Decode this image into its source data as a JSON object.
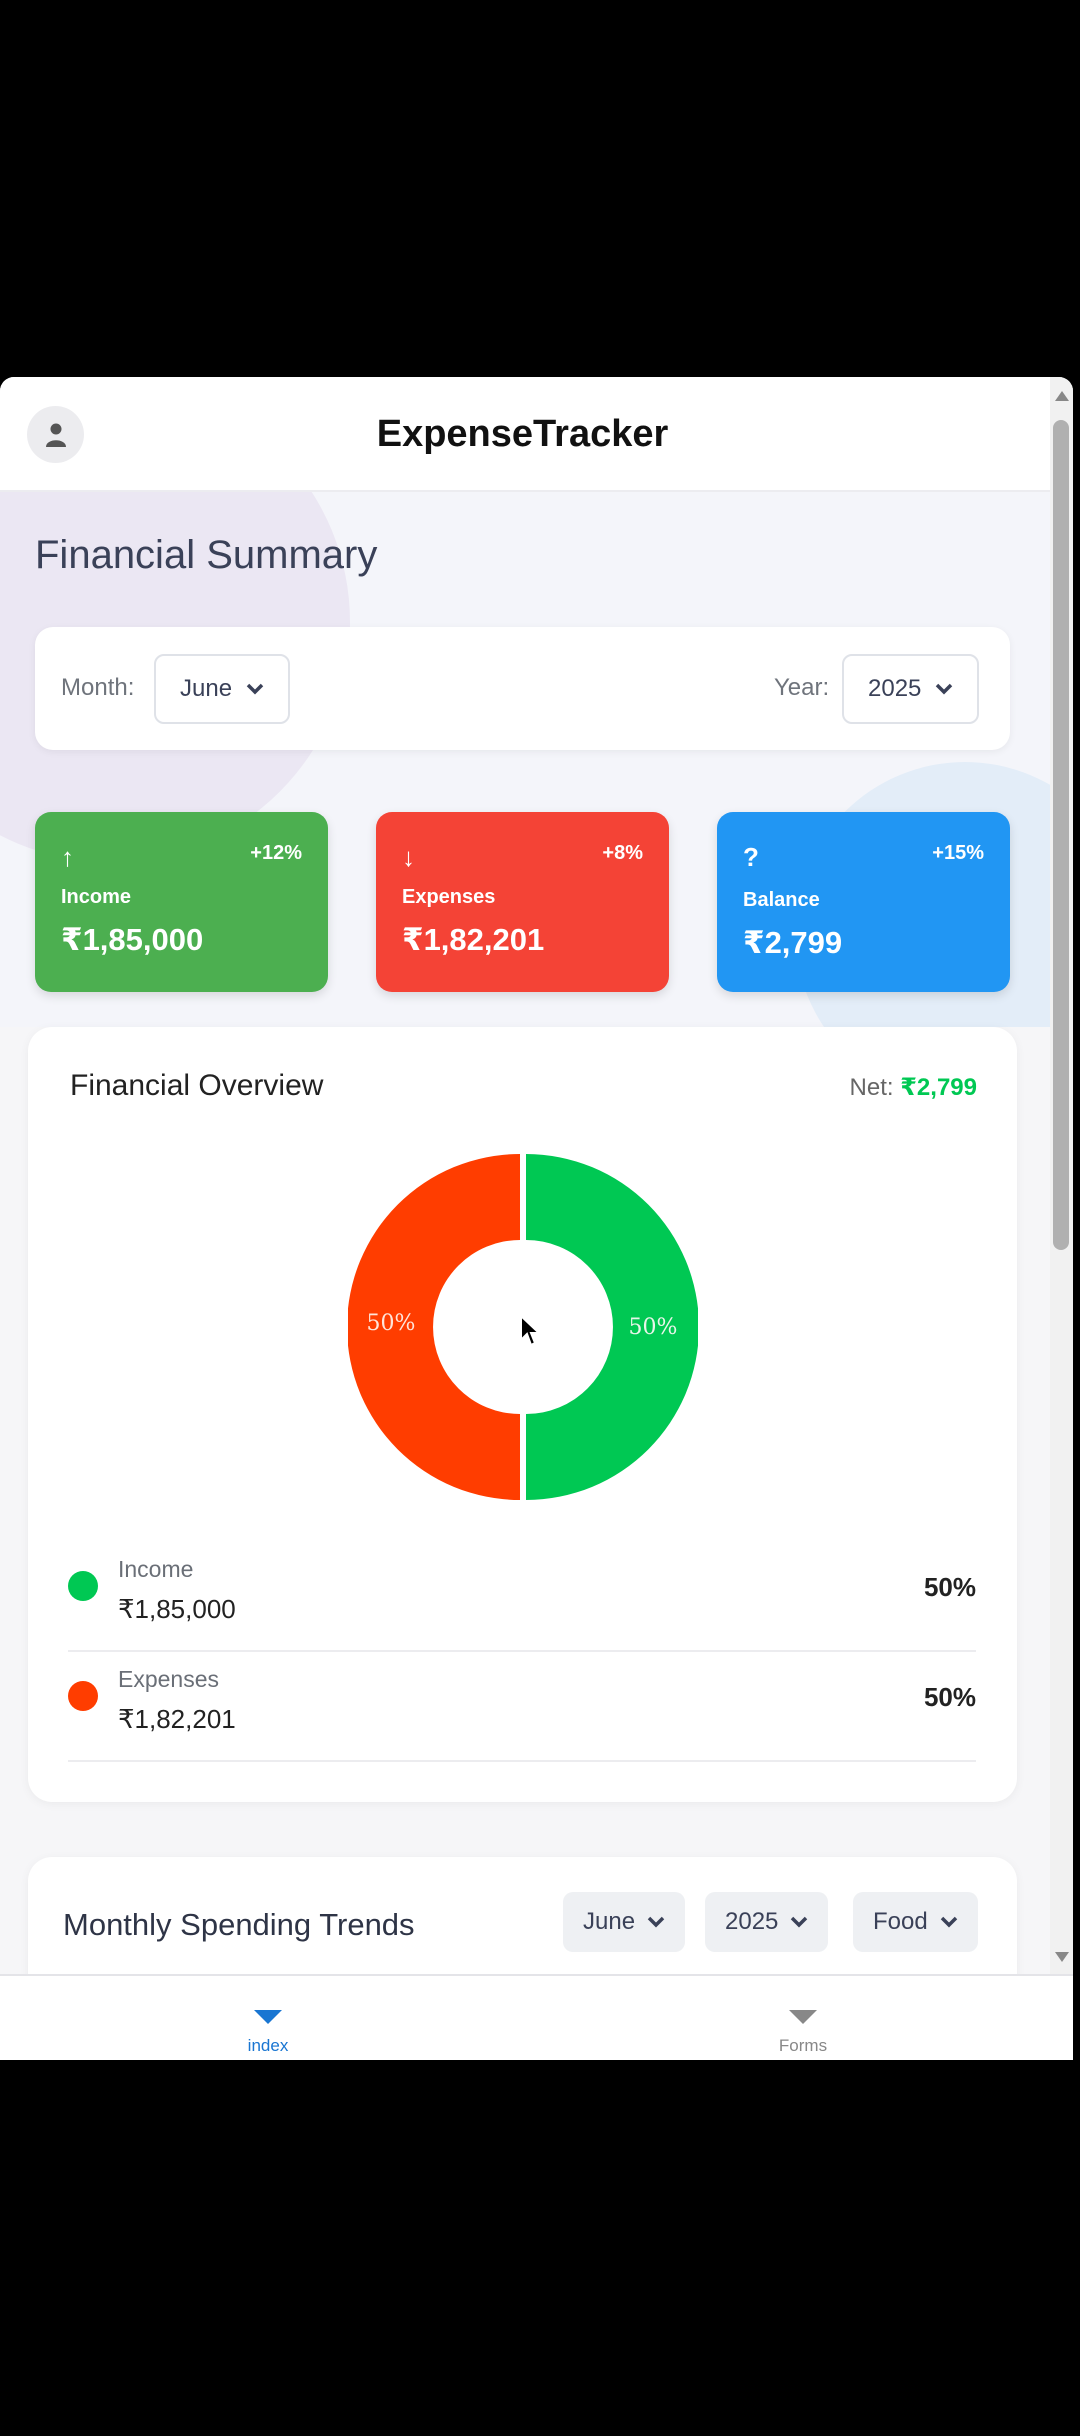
{
  "header": {
    "title": "ExpenseTracker",
    "avatar_icon": "user-icon"
  },
  "summary": {
    "title": "Financial Summary",
    "month_label": "Month:",
    "month_value": "June",
    "year_label": "Year:",
    "year_value": "2025",
    "cards": [
      {
        "icon": "↑",
        "change": "+12%",
        "label": "Income",
        "amount": "₹1,85,000",
        "color": "#4caf50"
      },
      {
        "icon": "↓",
        "change": "+8%",
        "label": "Expenses",
        "amount": "₹1,82,201",
        "color": "#f44336"
      },
      {
        "icon": "?",
        "change": "+15%",
        "label": "Balance",
        "amount": "₹2,799",
        "color": "#2196f3"
      }
    ]
  },
  "overview": {
    "title": "Financial Overview",
    "net_label": "Net:",
    "net_value": "₹2,799",
    "chart": {
      "income_pct": "50%",
      "expenses_pct": "50%",
      "income_color": "#00c853",
      "expenses_color": "#ff3d00"
    },
    "legend": [
      {
        "name": "Income",
        "amount": "₹1,85,000",
        "pct": "50%"
      },
      {
        "name": "Expenses",
        "amount": "₹1,82,201",
        "pct": "50%"
      }
    ]
  },
  "trends": {
    "title": "Monthly Spending Trends",
    "month": "June",
    "year": "2025",
    "category": "Food"
  },
  "nav": {
    "items": [
      {
        "label": "index",
        "active": true
      },
      {
        "label": "Forms",
        "active": false
      }
    ]
  }
}
